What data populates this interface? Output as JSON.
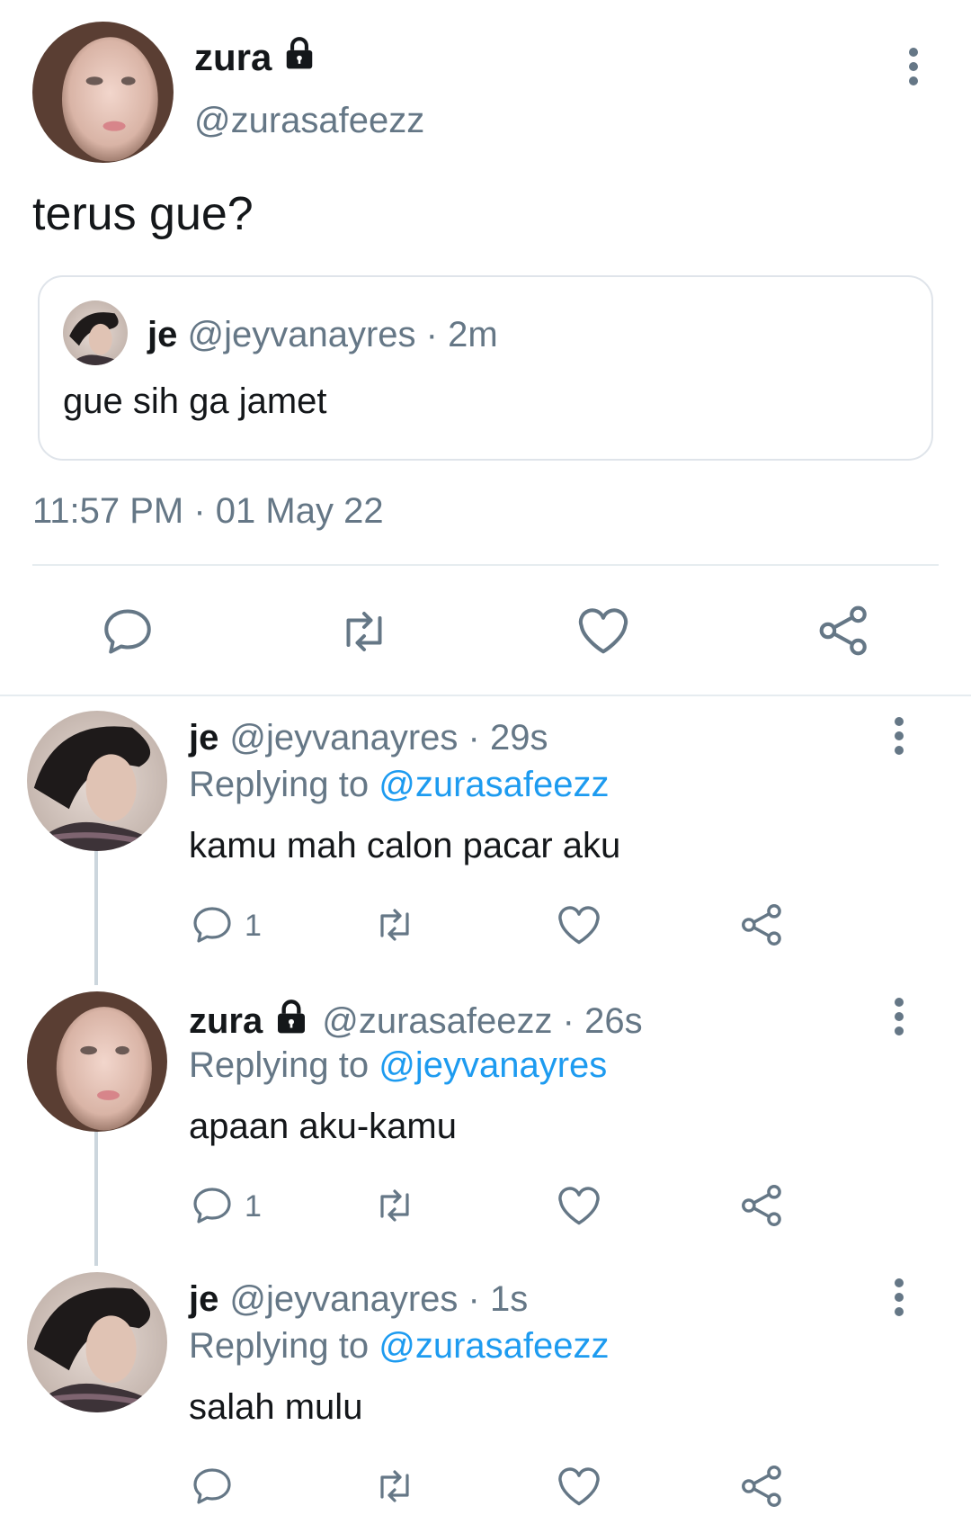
{
  "main_tweet": {
    "name": "zura",
    "handle": "@zurasafeezz",
    "text": "terus gue?",
    "timestamp": "11:57 PM · 01 May 22",
    "quoted": {
      "name": "je",
      "handle": "@jeyvanayres",
      "time": "2m",
      "text": "gue sih ga jamet"
    }
  },
  "replies": [
    {
      "name": "je",
      "handle": "@jeyvanayres",
      "time": "29s",
      "replying_prefix": "Replying to",
      "replying_to": "@zurasafeezz",
      "text": "kamu mah calon pacar aku",
      "reply_count": "1",
      "locked": false
    },
    {
      "name": "zura",
      "handle": "@zurasafeezz",
      "time": "26s",
      "replying_prefix": "Replying to",
      "replying_to": "@jeyvanayres",
      "text": "apaan aku-kamu",
      "reply_count": "1",
      "locked": true
    },
    {
      "name": "je",
      "handle": "@jeyvanayres",
      "time": "1s",
      "replying_prefix": "Replying to",
      "replying_to": "@zurasafeezz",
      "text": "salah mulu",
      "reply_count": "",
      "locked": false
    }
  ],
  "icons": {
    "reply": "reply-icon",
    "retweet": "retweet-icon",
    "like": "heart-icon",
    "share": "share-icon",
    "more": "more-vertical-icon",
    "lock": "lock-icon"
  },
  "colors": {
    "text_primary": "#14171a",
    "text_secondary": "#657786",
    "mention": "#1d9bf0",
    "divider": "#e6ecf0"
  }
}
